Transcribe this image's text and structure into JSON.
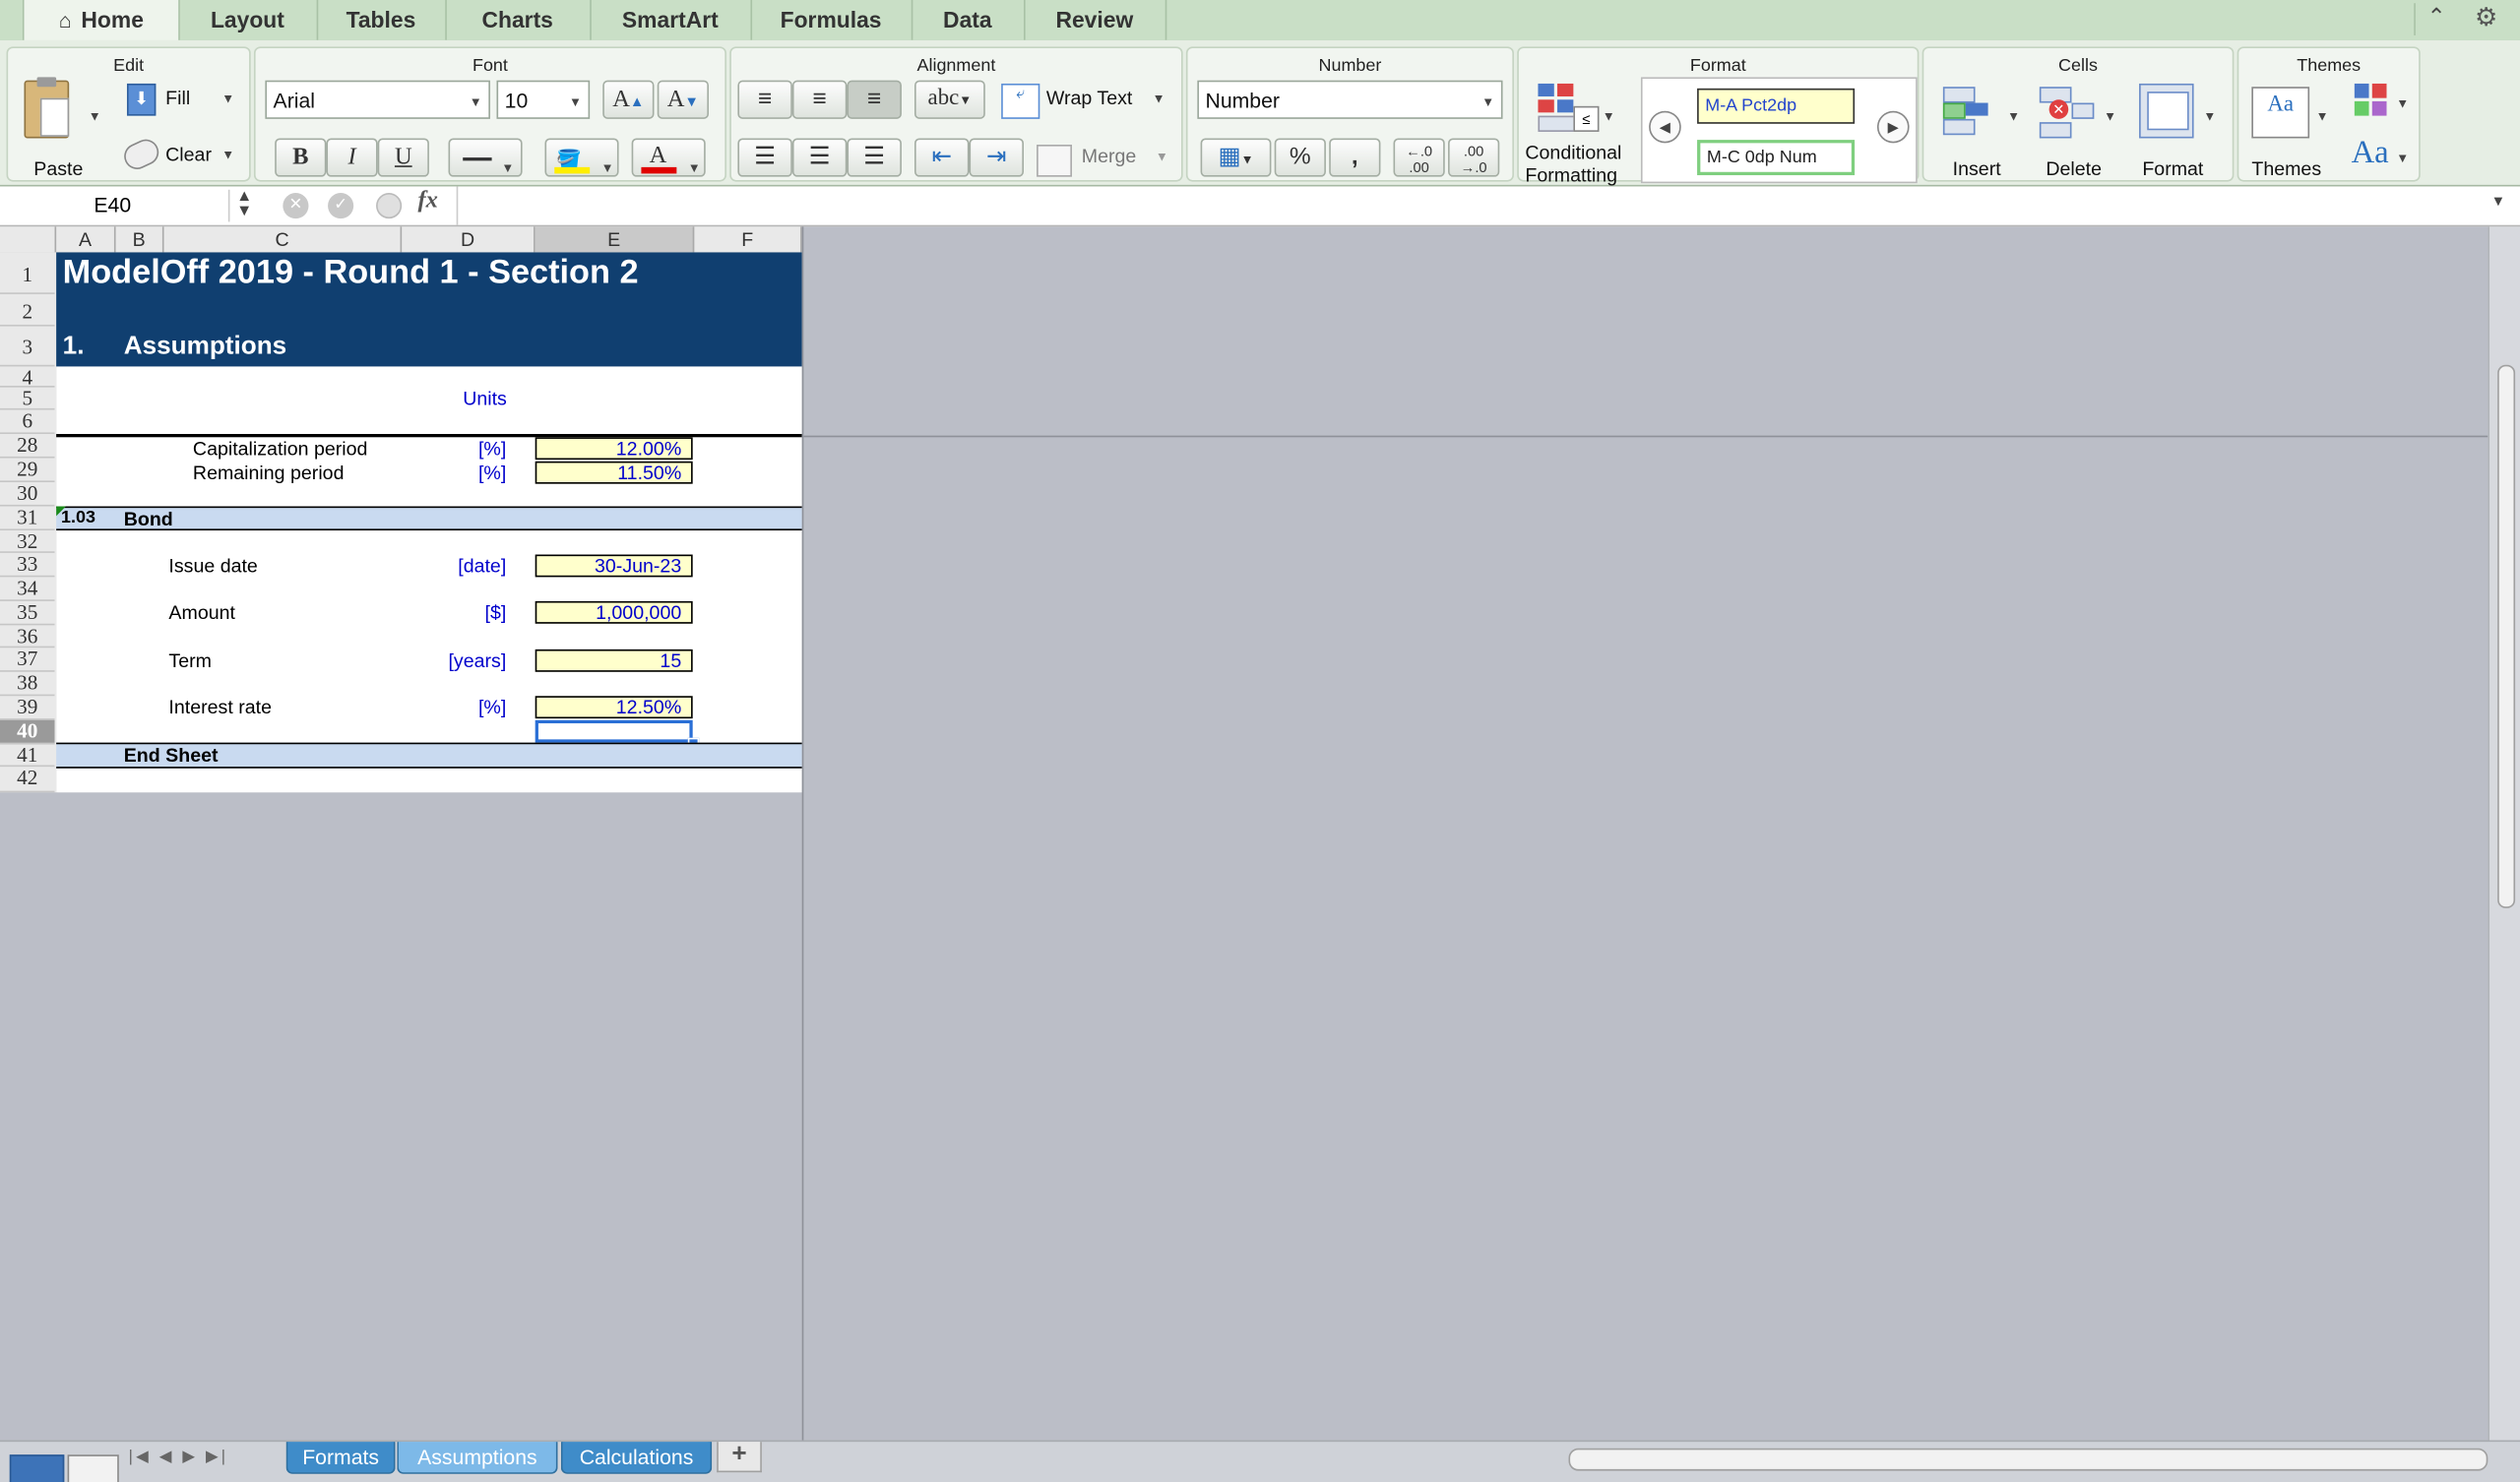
{
  "ribbon_tabs": [
    {
      "label": "Home"
    },
    {
      "label": "Layout"
    },
    {
      "label": "Tables"
    },
    {
      "label": "Charts"
    },
    {
      "label": "SmartArt"
    },
    {
      "label": "Formulas"
    },
    {
      "label": "Data"
    },
    {
      "label": "Review"
    }
  ],
  "groups": {
    "edit": "Edit",
    "font": "Font",
    "alignment": "Alignment",
    "number": "Number",
    "format": "Format",
    "cells": "Cells",
    "themes": "Themes"
  },
  "edit": {
    "paste": "Paste",
    "fill": "Fill",
    "clear": "Clear"
  },
  "font": {
    "name": "Arial",
    "size": "10",
    "bold": "B",
    "italic": "I",
    "underline": "U",
    "grow": "A",
    "shrink": "A",
    "color_glyph": "A"
  },
  "alignment": {
    "orientation": "abc",
    "wrap_text": "Wrap Text",
    "merge": "Merge"
  },
  "number": {
    "format": "Number",
    "percent": "%",
    "comma": ","
  },
  "format": {
    "conditional": "Conditional",
    "conditional2": "Formatting",
    "style1": "M-A Pct2dp",
    "style2": "M-C 0dp Num"
  },
  "cells": {
    "insert": "Insert",
    "delete": "Delete",
    "format": "Format"
  },
  "themes": {
    "themes": "Themes",
    "aa": "Aa"
  },
  "formula_bar": {
    "name_box": "E40",
    "fx": "fx",
    "formula": ""
  },
  "columns": [
    "A",
    "B",
    "C",
    "D",
    "E",
    "F"
  ],
  "rows": [
    "1",
    "2",
    "3",
    "4",
    "5",
    "6",
    "28",
    "29",
    "30",
    "31",
    "32",
    "33",
    "34",
    "35",
    "36",
    "37",
    "38",
    "39",
    "40",
    "41",
    "42"
  ],
  "sheet": {
    "title": "ModelOff 2019 - Round 1 - Section 2",
    "section_num": "1.",
    "section_title": "Assumptions",
    "units_header": "Units",
    "cap_period": {
      "label": "Capitalization period",
      "unit": "[%]",
      "value": "12.00%"
    },
    "rem_period": {
      "label": "Remaining period",
      "unit": "[%]",
      "value": "11.50%"
    },
    "bond_num": "1.03",
    "bond_title": "Bond",
    "issue_date": {
      "label": "Issue date",
      "unit": "[date]",
      "value": "30-Jun-23"
    },
    "amount": {
      "label": "Amount",
      "unit": "[$]",
      "value": "1,000,000"
    },
    "term": {
      "label": "Term",
      "unit": "[years]",
      "value": "15"
    },
    "interest": {
      "label": "Interest rate",
      "unit": "[%]",
      "value": "12.50%"
    },
    "end_sheet": "End Sheet"
  },
  "sheet_tabs": [
    {
      "label": "Formats"
    },
    {
      "label": "Assumptions"
    },
    {
      "label": "Calculations"
    }
  ],
  "add_sheet": "+",
  "colors": {
    "title_bg": "#103f70",
    "section_bg": "#c9daf0",
    "input_bg": "#ffffcc",
    "unit_color": "#0000cc"
  }
}
